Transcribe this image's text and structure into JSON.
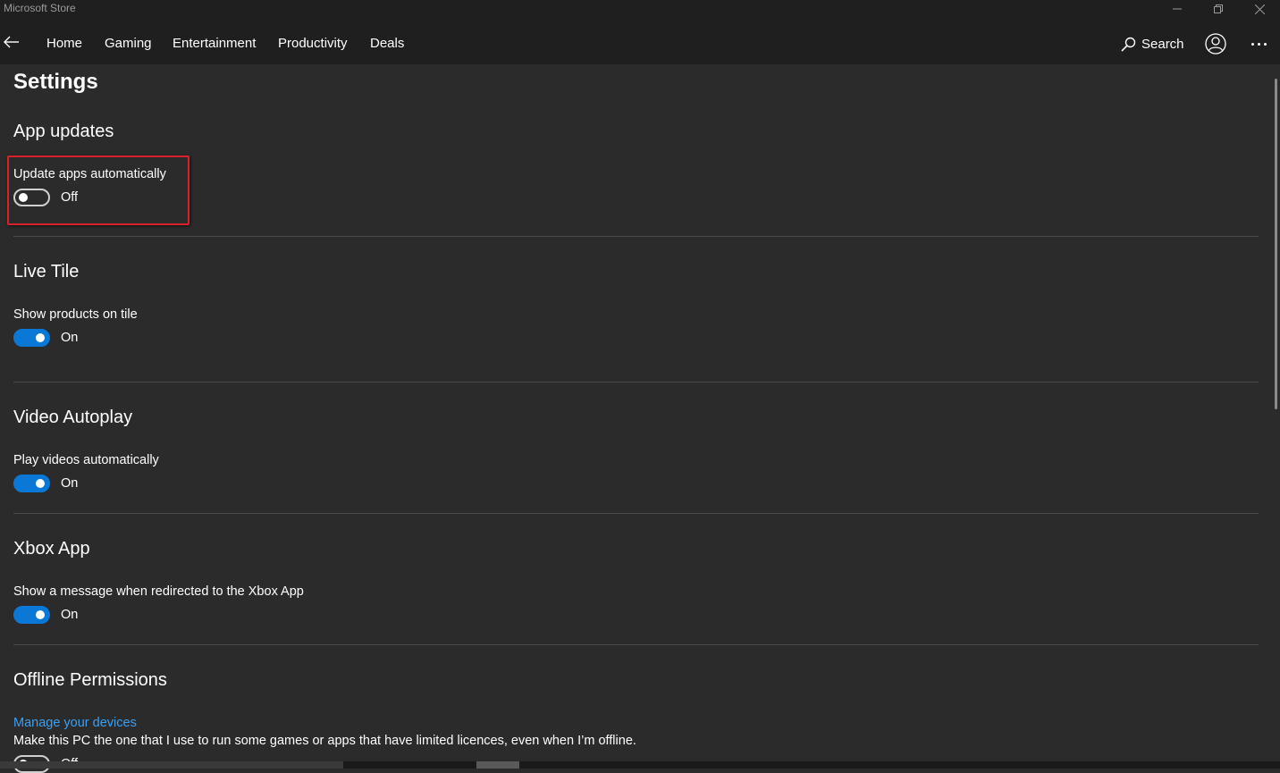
{
  "window": {
    "title": "Microsoft Store"
  },
  "nav": {
    "items": [
      {
        "label": "Home"
      },
      {
        "label": "Gaming"
      },
      {
        "label": "Entertainment"
      },
      {
        "label": "Productivity"
      },
      {
        "label": "Deals"
      }
    ],
    "search_label": "Search"
  },
  "page": {
    "title": "Settings"
  },
  "sections": {
    "app_updates": {
      "title": "App updates",
      "setting_label": "Update apps automatically",
      "state": "Off"
    },
    "live_tile": {
      "title": "Live Tile",
      "setting_label": "Show products on tile",
      "state": "On"
    },
    "video_autoplay": {
      "title": "Video Autoplay",
      "setting_label": "Play videos automatically",
      "state": "On"
    },
    "xbox_app": {
      "title": "Xbox App",
      "setting_label": "Show a message when redirected to the Xbox App",
      "state": "On"
    },
    "offline_permissions": {
      "title": "Offline Permissions",
      "link_label": "Manage your devices",
      "description": "Make this PC the one that I use to run some games or apps that have limited licences, even when I’m offline.",
      "state": "Off"
    }
  },
  "colors": {
    "accent": "#0a78d7",
    "link": "#3aa0f3",
    "highlight_border": "#d9202b",
    "background": "#2b2b2b",
    "header": "#1f1f1f"
  },
  "icons": {
    "back": "back-arrow-icon",
    "search": "search-icon",
    "account": "account-icon",
    "more": "more-icon",
    "minimize": "minimize-icon",
    "maximize": "restore-icon",
    "close": "close-icon"
  }
}
